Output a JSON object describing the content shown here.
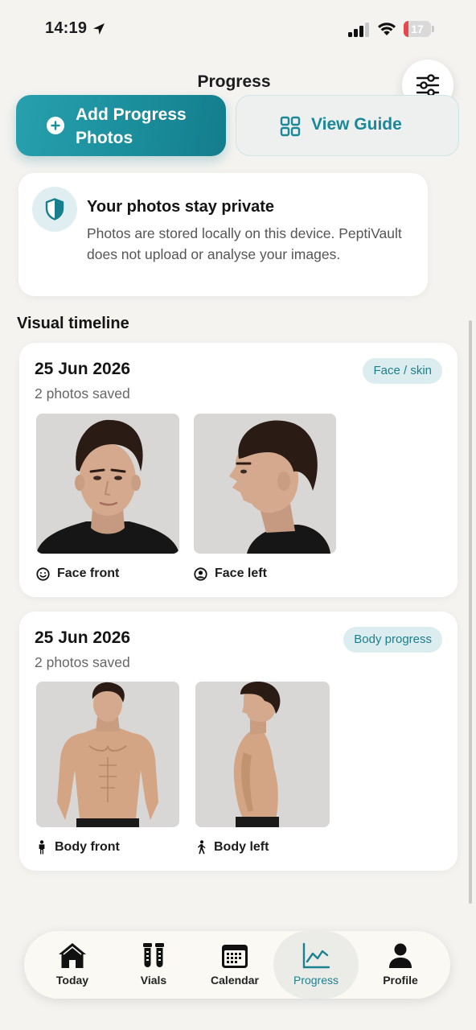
{
  "status_bar": {
    "time": "14:19",
    "battery_level": "17",
    "battery_fraction": 0.17,
    "location_icon": "location-arrow-icon",
    "signal_icon": "cellular-signal-icon",
    "wifi_icon": "wifi-icon"
  },
  "header": {
    "title": "Progress",
    "filter_icon": "sliders-icon"
  },
  "actions": {
    "add_photos_label": "Add Progress Photos",
    "add_photos_icon": "plus-circle-icon",
    "guide_label": "View Guide",
    "guide_icon": "grid-icon"
  },
  "privacy": {
    "icon": "shield-icon",
    "title": "Your photos stay private",
    "body": "Photos are stored locally on this device. PeptiVault does not upload or analyse your images."
  },
  "timeline": {
    "title": "Visual timeline",
    "entries": [
      {
        "date": "25 Jun 2026",
        "count": "2 photos saved",
        "tag": "Face / skin",
        "photos": [
          {
            "caption": "Face front",
            "icon": "smiley-face-icon"
          },
          {
            "caption": "Face left",
            "icon": "user-circle-icon"
          }
        ]
      },
      {
        "date": "25 Jun 2026",
        "count": "2 photos saved",
        "tag": "Body progress",
        "photos": [
          {
            "caption": "Body front",
            "icon": "standing-person-icon"
          },
          {
            "caption": "Body left",
            "icon": "walking-person-icon"
          }
        ]
      }
    ]
  },
  "tab_bar": {
    "active": "Progress",
    "tabs": [
      {
        "label": "Today",
        "icon": "home-icon"
      },
      {
        "label": "Vials",
        "icon": "vials-icon"
      },
      {
        "label": "Calendar",
        "icon": "calendar-icon"
      },
      {
        "label": "Progress",
        "icon": "line-chart-icon"
      },
      {
        "label": "Profile",
        "icon": "profile-icon"
      }
    ]
  },
  "colors": {
    "accent": "#1b8797",
    "accent_light": "#dcedef",
    "background": "#f4f3f0",
    "battery_low": "#e5484d"
  }
}
